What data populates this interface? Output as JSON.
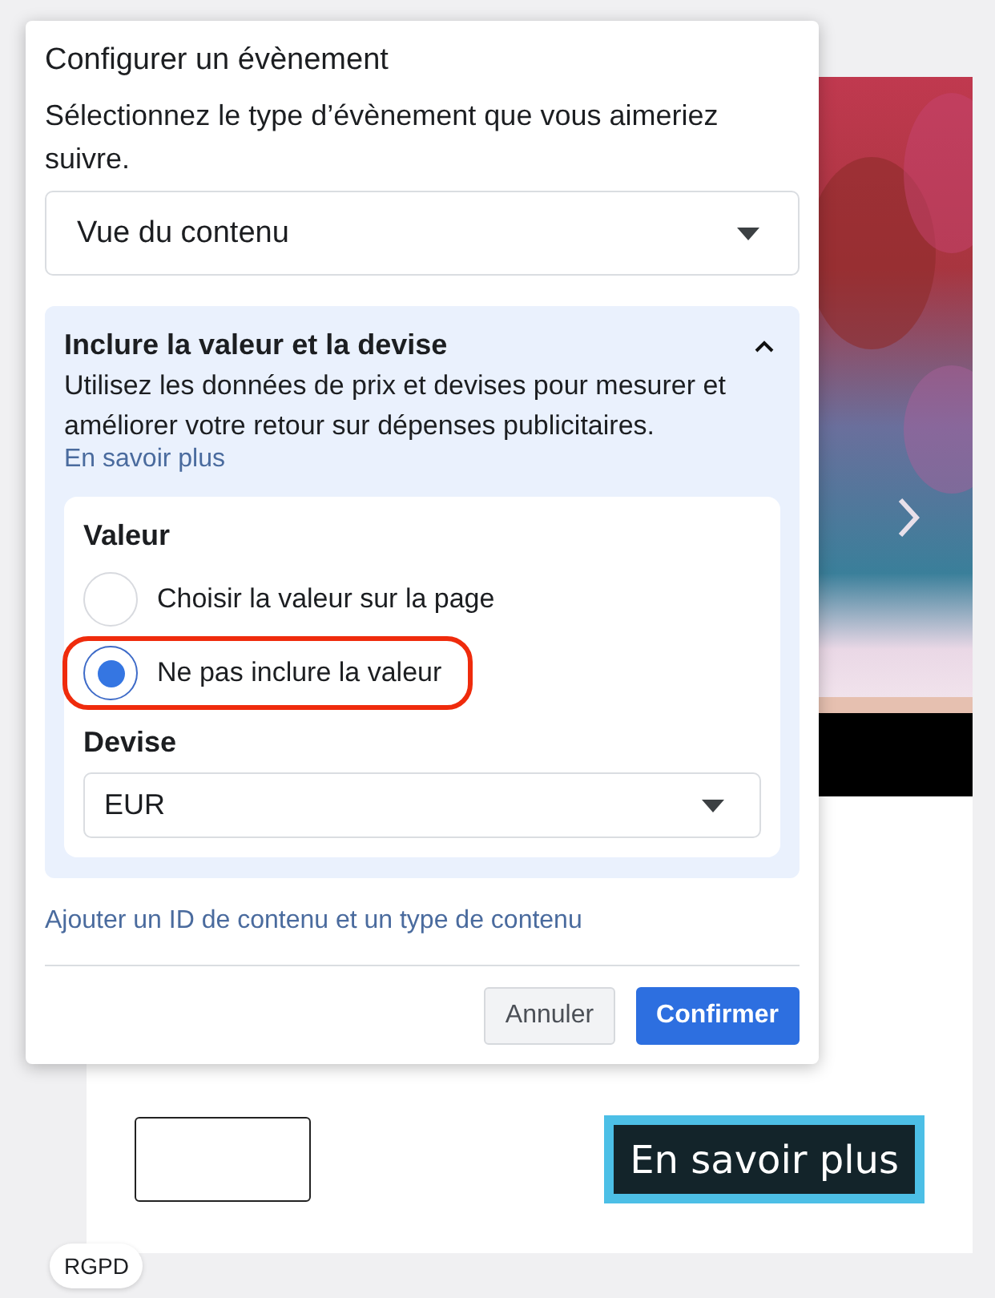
{
  "page": {
    "cta_button": "En savoir plus",
    "badge": "RGPD"
  },
  "dialog": {
    "title": "Configurer un évènement",
    "description": "Sélectionnez le type d’évènement que vous aimeriez suivre.",
    "event_select": {
      "value": "Vue du contenu"
    },
    "panel": {
      "title": "Inclure la valeur et la devise",
      "expanded": true,
      "description": "Utilisez les données de prix et devises pour mesurer et améliorer votre retour sur dépenses publicitaires.",
      "link": "En savoir plus",
      "value_label": "Valeur",
      "options": [
        {
          "label": "Choisir la valeur sur la page",
          "selected": false,
          "highlighted": false
        },
        {
          "label": "Ne pas inclure la valeur",
          "selected": true,
          "highlighted": true
        }
      ],
      "currency_label": "Devise",
      "currency_select": {
        "value": "EUR"
      }
    },
    "extra_link": "Ajouter un ID de contenu et un type de contenu",
    "buttons": [
      {
        "label": "Annuler",
        "kind": "secondary"
      },
      {
        "label": "Confirmer",
        "kind": "primary"
      }
    ]
  }
}
